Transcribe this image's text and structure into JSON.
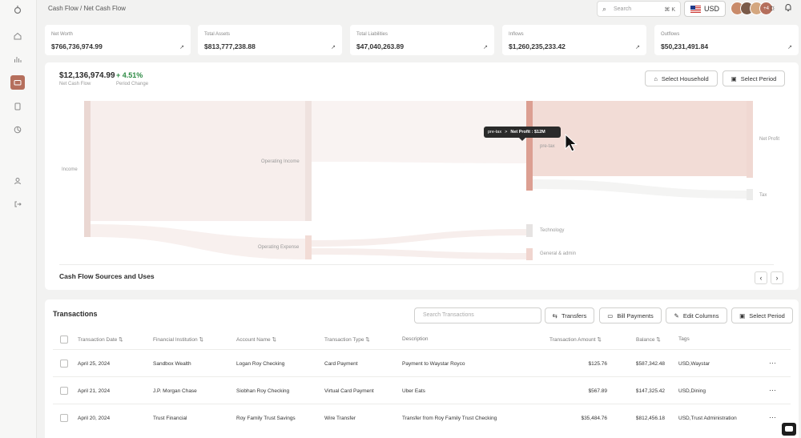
{
  "breadcrumb": "Cash Flow / Net Cash Flow",
  "search": {
    "placeholder": "Search",
    "shortcut": "⌘ K"
  },
  "currency": "USD",
  "avatars": {
    "extra_count": "+4"
  },
  "stats": [
    {
      "label": "Net Worth",
      "value": "$766,736,974.99"
    },
    {
      "label": "Total Assets",
      "value": "$813,777,238.88"
    },
    {
      "label": "Total Liabilities",
      "value": "$47,040,263.89"
    },
    {
      "label": "Inflows",
      "value": "$1,260,235,233.42"
    },
    {
      "label": "Outflows",
      "value": "$50,231,491.84"
    }
  ],
  "net_cash_flow": {
    "value": "$12,136,974.99",
    "label": "Net Cash Flow"
  },
  "period_change": {
    "value": "+ 4.51%",
    "label": "Period Change"
  },
  "buttons": {
    "select_household": "Select Household",
    "select_period": "Select Period"
  },
  "sankey": {
    "nodes": {
      "income": "Income",
      "operating_income": "Operating Income",
      "operating_expense": "Operating Expense",
      "pre_tax": "pre-tax",
      "technology": "Technology",
      "general_admin": "General & admin",
      "net_profit": "Net Profit",
      "tax": "Tax"
    },
    "tooltip": {
      "from": "pre-tax",
      "arrow": ">",
      "to": "Net Profit : $12M"
    }
  },
  "cash_flow_title": "Cash Flow Sources and Uses",
  "transactions": {
    "title": "Transactions",
    "search_placeholder": "Search Transactions",
    "buttons": {
      "transfers": "Transfers",
      "bill_payments": "Bill Payments",
      "edit_columns": "Edit Columns",
      "select_period": "Select Period"
    },
    "columns": [
      "Transaction Date",
      "Financial Institution",
      "Account Name",
      "Transaction Type",
      "Description",
      "Transaction Amount",
      "Balance",
      "Tags"
    ],
    "rows": [
      {
        "date": "April 25, 2024",
        "institution": "Sandbox Wealth",
        "account": "Logan Roy Checking",
        "type": "Card Payment",
        "description": "Payment to Waystar Royco",
        "amount": "$125.76",
        "balance": "$587,342.48",
        "tags": "USD,Waystar"
      },
      {
        "date": "April 21, 2024",
        "institution": "J.P. Morgan Chase",
        "account": "Siobhan Roy Checking",
        "type": "Virtual Card Payment",
        "description": "Uber Eats",
        "amount": "$567.89",
        "balance": "$147,325.42",
        "tags": "USD,Dining"
      },
      {
        "date": "April 20, 2024",
        "institution": "Trust Financial",
        "account": "Roy Family Trust Savings",
        "type": "Wire Transfer",
        "description": "Transfer from Roy Family Trust Checking",
        "amount": "$35,484.76",
        "balance": "$812,456.18",
        "tags": "USD,Trust Administration"
      }
    ]
  },
  "colors": {
    "accent": "#b56f5c",
    "positive": "#2e8b45"
  }
}
